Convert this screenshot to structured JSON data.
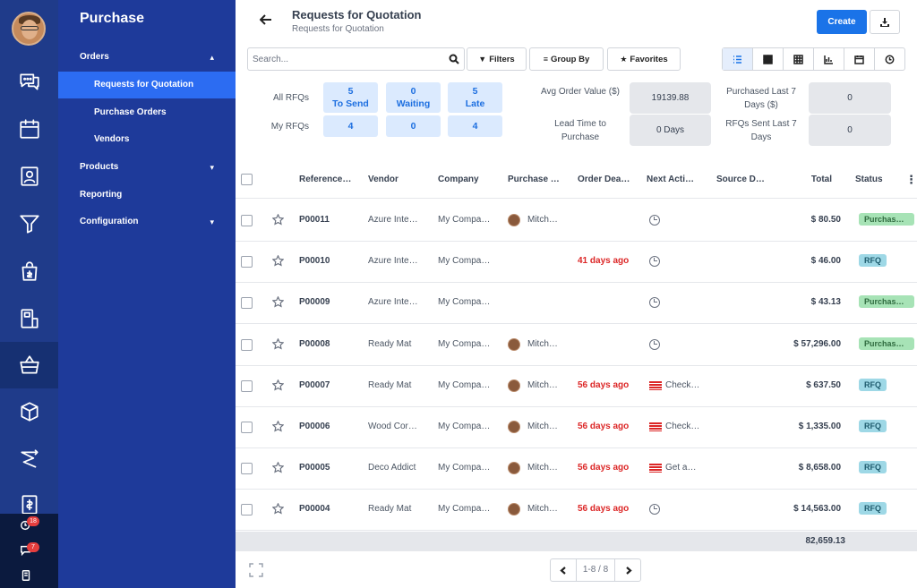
{
  "app": {
    "title": "Purchase"
  },
  "notifications": {
    "activity_count": "18",
    "messages_count": "7"
  },
  "sidebar": {
    "items": [
      {
        "label": "Orders",
        "chevron": "▴"
      },
      {
        "label": "Requests for Quotation"
      },
      {
        "label": "Purchase Orders"
      },
      {
        "label": "Vendors"
      },
      {
        "label": "Products",
        "chevron": "▾"
      },
      {
        "label": "Reporting"
      },
      {
        "label": "Configuration",
        "chevron": "▾"
      }
    ]
  },
  "header": {
    "title": "Requests for Quotation",
    "breadcrumb": "Requests for Quotation",
    "create_label": "Create"
  },
  "toolbar": {
    "search_placeholder": "Search...",
    "filters_label": "Filters",
    "group_by_label": "Group By",
    "favorites_label": "Favorites"
  },
  "dashboard": {
    "all_rfqs_label": "All RFQs",
    "my_rfqs_label": "My RFQs",
    "stats": [
      {
        "all": "5",
        "mine": "4",
        "label": "To Send"
      },
      {
        "all": "0",
        "mine": "0",
        "label": "Waiting"
      },
      {
        "all": "5",
        "mine": "4",
        "label": "Late"
      }
    ],
    "avg_order_value_label": "Avg Order Value ($)",
    "avg_order_value": "19139.88",
    "lead_time_label": "Lead Time to Purchase",
    "lead_time": "0  Days",
    "purchased_last_7_label": "Purchased Last 7 Days ($)",
    "purchased_last_7": "0",
    "rfqs_sent_label": "RFQs Sent Last 7 Days",
    "rfqs_sent": "0"
  },
  "table": {
    "columns": [
      "Reference…",
      "Vendor",
      "Company",
      "Purchase …",
      "Order Dea…",
      "Next Acti…",
      "Source D…",
      "Total",
      "Status"
    ],
    "rows": [
      {
        "ref": "P00011",
        "vendor": "Azure Inte…",
        "company": "My Compa…",
        "rep": "Mitch…",
        "deadline": "",
        "activity": "",
        "total": "$ 80.50",
        "status": "Purchas…"
      },
      {
        "ref": "P00010",
        "vendor": "Azure Inte…",
        "company": "My Compa…",
        "rep": "",
        "deadline": "41 days ago",
        "activity": "",
        "total": "$ 46.00",
        "status": "RFQ"
      },
      {
        "ref": "P00009",
        "vendor": "Azure Inte…",
        "company": "My Compa…",
        "rep": "",
        "deadline": "",
        "activity": "",
        "total": "$ 43.13",
        "status": "Purchas…"
      },
      {
        "ref": "P00008",
        "vendor": "Ready Mat",
        "company": "My Compa…",
        "rep": "Mitch…",
        "deadline": "",
        "activity": "",
        "total": "$ 57,296.00",
        "status": "Purchas…"
      },
      {
        "ref": "P00007",
        "vendor": "Ready Mat",
        "company": "My Compa…",
        "rep": "Mitch…",
        "deadline": "56 days ago",
        "activity": "Check…",
        "total": "$ 637.50",
        "status": "RFQ"
      },
      {
        "ref": "P00006",
        "vendor": "Wood Cor…",
        "company": "My Compa…",
        "rep": "Mitch…",
        "deadline": "56 days ago",
        "activity": "Check…",
        "total": "$ 1,335.00",
        "status": "RFQ"
      },
      {
        "ref": "P00005",
        "vendor": "Deco Addict",
        "company": "My Compa…",
        "rep": "Mitch…",
        "deadline": "56 days ago",
        "activity": "Get a…",
        "total": "$ 8,658.00",
        "status": "RFQ"
      },
      {
        "ref": "P00004",
        "vendor": "Ready Mat",
        "company": "My Compa…",
        "rep": "Mitch…",
        "deadline": "56 days ago",
        "activity": "",
        "total": "$ 14,563.00",
        "status": "RFQ"
      }
    ],
    "grand_total": "82,659.13"
  },
  "pager": {
    "text": "1-8 / 8"
  },
  "colors": {
    "primary": "#1a73e8",
    "sidebar": "#1e3a9a",
    "rail": "#1f3b8a",
    "late": "#dc2626"
  }
}
